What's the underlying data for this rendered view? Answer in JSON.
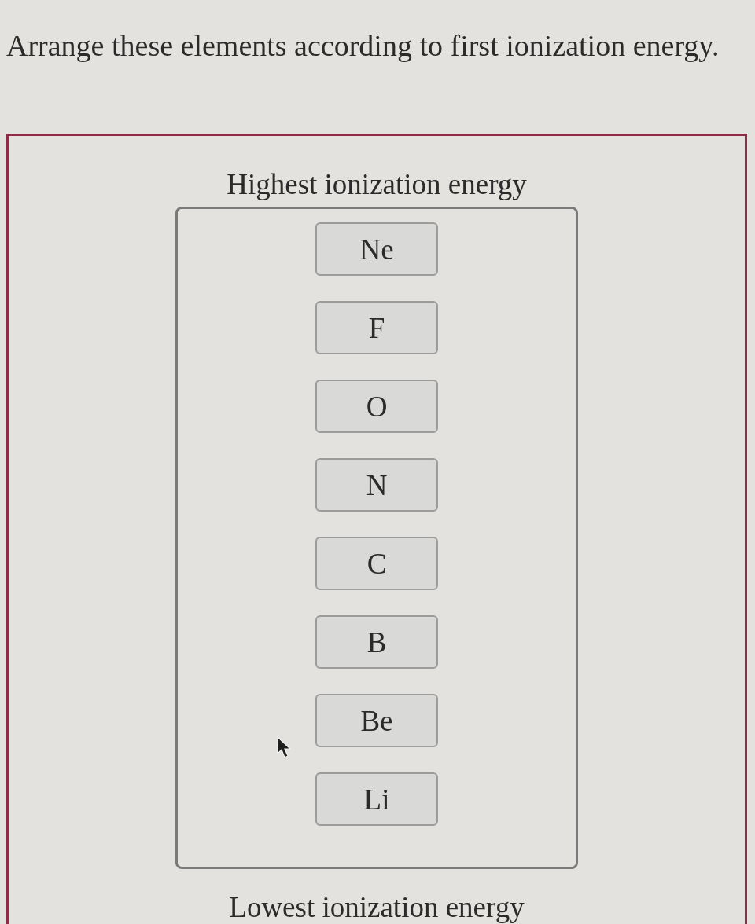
{
  "question": "Arrange these elements according to first ionization energy.",
  "ranking": {
    "top_label": "Highest ionization energy",
    "items": [
      {
        "label": "Ne"
      },
      {
        "label": "F"
      },
      {
        "label": "O"
      },
      {
        "label": "N"
      },
      {
        "label": "C"
      },
      {
        "label": "B"
      },
      {
        "label": "Be"
      },
      {
        "label": "Li"
      }
    ],
    "bottom_label": "Lowest ionization energy"
  }
}
